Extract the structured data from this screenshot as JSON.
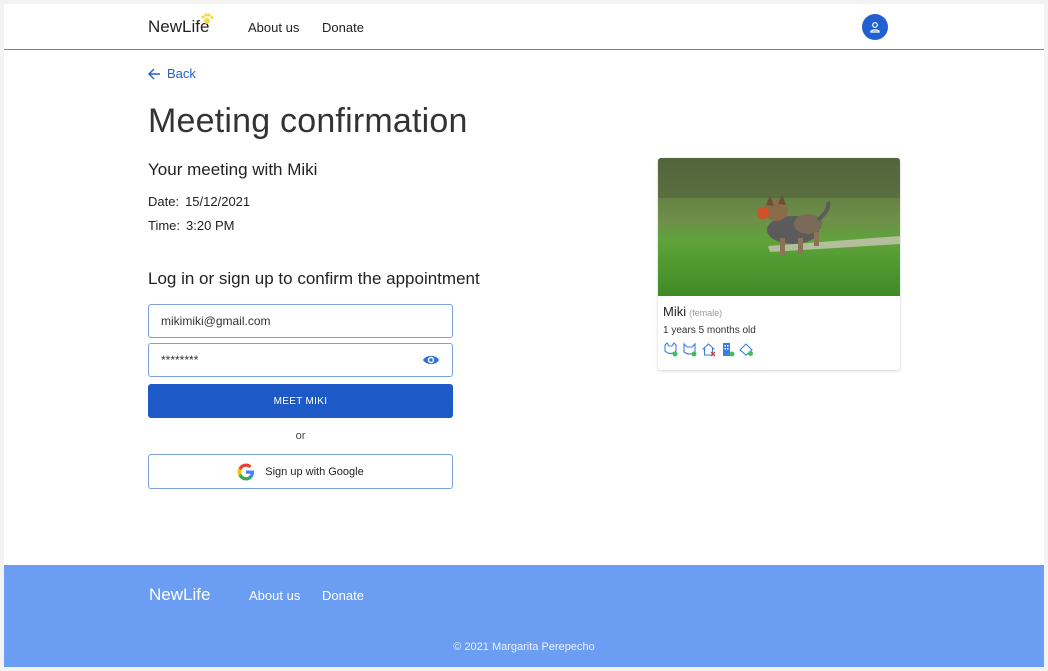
{
  "header": {
    "brand": "NewLife",
    "nav": [
      "About us",
      "Donate"
    ]
  },
  "main": {
    "back_label": "Back",
    "title": "Meeting confirmation",
    "subtitle": "Your meeting with Miki",
    "date_label": "Date:",
    "date_value": "15/12/2021",
    "time_label": "Time:",
    "time_value": "3:20 PM",
    "login_title": "Log in or sign up to confirm the appointment",
    "email_value": "mikimiki@gmail.com",
    "password_value": "********",
    "submit_label": "MEET MIKI",
    "or_label": "or",
    "google_label": "Sign up with Google"
  },
  "pet": {
    "name": "Miki",
    "gender": "(female)",
    "age": "1 years 5 months old",
    "trait_icons": [
      "dog-friendly-icon",
      "cat-friendly-icon",
      "no-house-icon",
      "apartment-ok-icon",
      "vaccinated-icon"
    ]
  },
  "footer": {
    "brand": "NewLife",
    "nav": [
      "About us",
      "Donate"
    ],
    "copyright": "© 2021 Margarita Perepecho"
  },
  "colors": {
    "primary": "#1d5ac8",
    "footer": "#6b9df2",
    "accent_paw": "#f5d94a"
  }
}
